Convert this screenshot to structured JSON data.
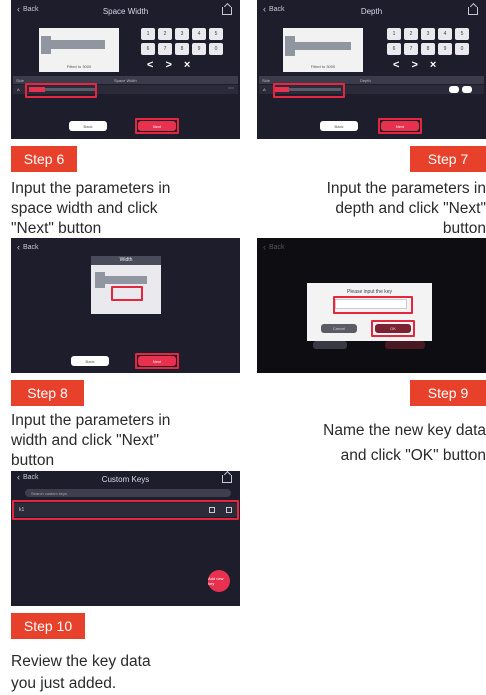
{
  "step6": {
    "back": "Back",
    "title": "Space Width",
    "numpad": [
      "1",
      "2",
      "3",
      "4",
      "5",
      "6",
      "7",
      "8",
      "9",
      "0"
    ],
    "arrows": [
      "<",
      ">",
      "×"
    ],
    "key_label": "Fitted to 3000",
    "table_headers": [
      "Side",
      "Space Width"
    ],
    "row_value": "A",
    "btn_back": "Back",
    "btn_next": "Next",
    "step_label": "Step 6",
    "description": [
      "Input the parameters in",
      "space width and click",
      "\"Next\" button"
    ]
  },
  "step7": {
    "back": "Back",
    "title": "Depth",
    "numpad": [
      "1",
      "2",
      "3",
      "4",
      "5",
      "6",
      "7",
      "8",
      "9",
      "0"
    ],
    "arrows": [
      "<",
      ">",
      "×"
    ],
    "key_label": "Fitted to 3000",
    "table_headers": [
      "Side",
      "Depth"
    ],
    "row_value": "A",
    "btn_back": "Back",
    "btn_next": "Next",
    "step_label": "Step 7",
    "description": [
      "Input the parameters in",
      "depth and click \"Next\"",
      "button"
    ]
  },
  "step8": {
    "back": "Back",
    "title": "Width",
    "btn_back": "Back",
    "btn_next": "Next",
    "step_label": "Step 8",
    "description": [
      "Input the parameters in",
      "width and click \"Next\"",
      "button"
    ]
  },
  "step9": {
    "back": "Back",
    "dialog_title": "Please input the key",
    "btn_cancel": "Cancel",
    "btn_ok": "OK",
    "step_label": "Step 9",
    "description": [
      "Name the new key data",
      "and click \"OK\" button"
    ]
  },
  "step10": {
    "back": "Back",
    "title": "Custom Keys",
    "search_placeholder": "Search custom keys",
    "row_name": "k1",
    "fab_label": "Add new key",
    "step_label": "Step 10",
    "description": [
      "Review the key data",
      "you just added."
    ]
  },
  "colors": {
    "accent": "#e8412b",
    "highlight": "#e4273f",
    "screen_bg": "#1d1d2c",
    "button_red": "#e8304f"
  }
}
